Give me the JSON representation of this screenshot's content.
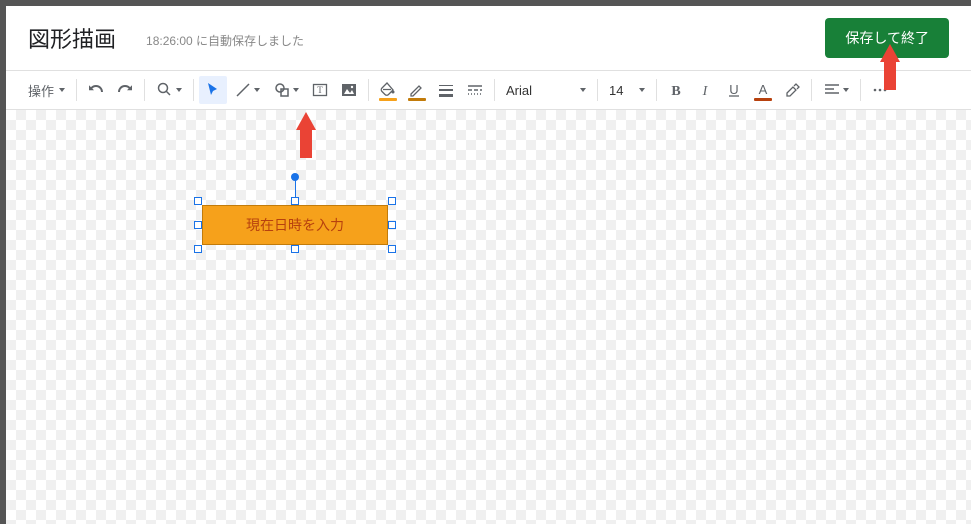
{
  "header": {
    "title": "図形描画",
    "autosave": "18:26:00 に自動保存しました",
    "save_button": "保存して終了"
  },
  "toolbar": {
    "actions_label": "操作",
    "font": "Arial",
    "font_size": "14",
    "fill_underline": "#f6a11b",
    "border_underline": "#c27b0a",
    "text_color_underline": "#b7410e"
  },
  "canvas": {
    "shape_text": "現在日時を入力"
  },
  "icons": {
    "select": "select-icon",
    "line": "line-icon",
    "shape": "shape-icon",
    "textbox": "textbox-icon",
    "image": "image-icon",
    "fill": "fill-icon",
    "border": "border-icon",
    "border_weight": "border-weight-icon",
    "border_dash": "border-dash-icon",
    "bold": "bold-icon",
    "italic": "italic-icon",
    "underline": "underline-icon",
    "text_color": "text-color-icon",
    "highlight": "highlight-icon",
    "align": "align-icon",
    "more": "more-icon",
    "undo": "undo-icon",
    "redo": "redo-icon",
    "zoom": "zoom-icon"
  }
}
